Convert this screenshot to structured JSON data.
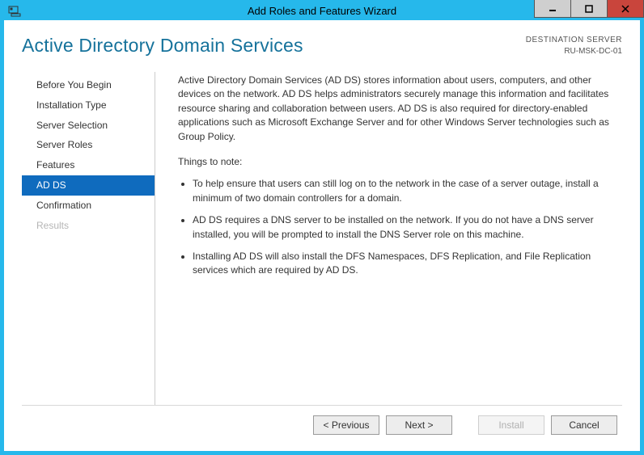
{
  "window": {
    "title": "Add Roles and Features Wizard"
  },
  "header": {
    "page_title": "Active Directory Domain Services",
    "destination_label": "DESTINATION SERVER",
    "destination_value": "RU-MSK-DC-01"
  },
  "sidebar": {
    "items": [
      {
        "label": "Before You Begin",
        "selected": false,
        "disabled": false
      },
      {
        "label": "Installation Type",
        "selected": false,
        "disabled": false
      },
      {
        "label": "Server Selection",
        "selected": false,
        "disabled": false
      },
      {
        "label": "Server Roles",
        "selected": false,
        "disabled": false
      },
      {
        "label": "Features",
        "selected": false,
        "disabled": false
      },
      {
        "label": "AD DS",
        "selected": true,
        "disabled": false
      },
      {
        "label": "Confirmation",
        "selected": false,
        "disabled": false
      },
      {
        "label": "Results",
        "selected": false,
        "disabled": true
      }
    ]
  },
  "main": {
    "intro": "Active Directory Domain Services (AD DS) stores information about users, computers, and other devices on the network.  AD DS helps administrators securely manage this information and facilitates resource sharing and collaboration between users.  AD DS is also required for directory-enabled applications such as Microsoft Exchange Server and for other Windows Server technologies such as Group Policy.",
    "notes_heading": "Things to note:",
    "notes": [
      "To help ensure that users can still log on to the network in the case of a server outage, install a minimum of two domain controllers for a domain.",
      "AD DS requires a DNS server to be installed on the network.  If you do not have a DNS server installed, you will be prompted to install the DNS Server role on this machine.",
      "Installing AD DS will also install the DFS Namespaces, DFS Replication, and File Replication services which are required by AD DS."
    ]
  },
  "footer": {
    "previous": "< Previous",
    "next": "Next >",
    "install": "Install",
    "cancel": "Cancel",
    "install_enabled": false
  },
  "icons": {
    "server_manager": "server-manager-icon"
  }
}
